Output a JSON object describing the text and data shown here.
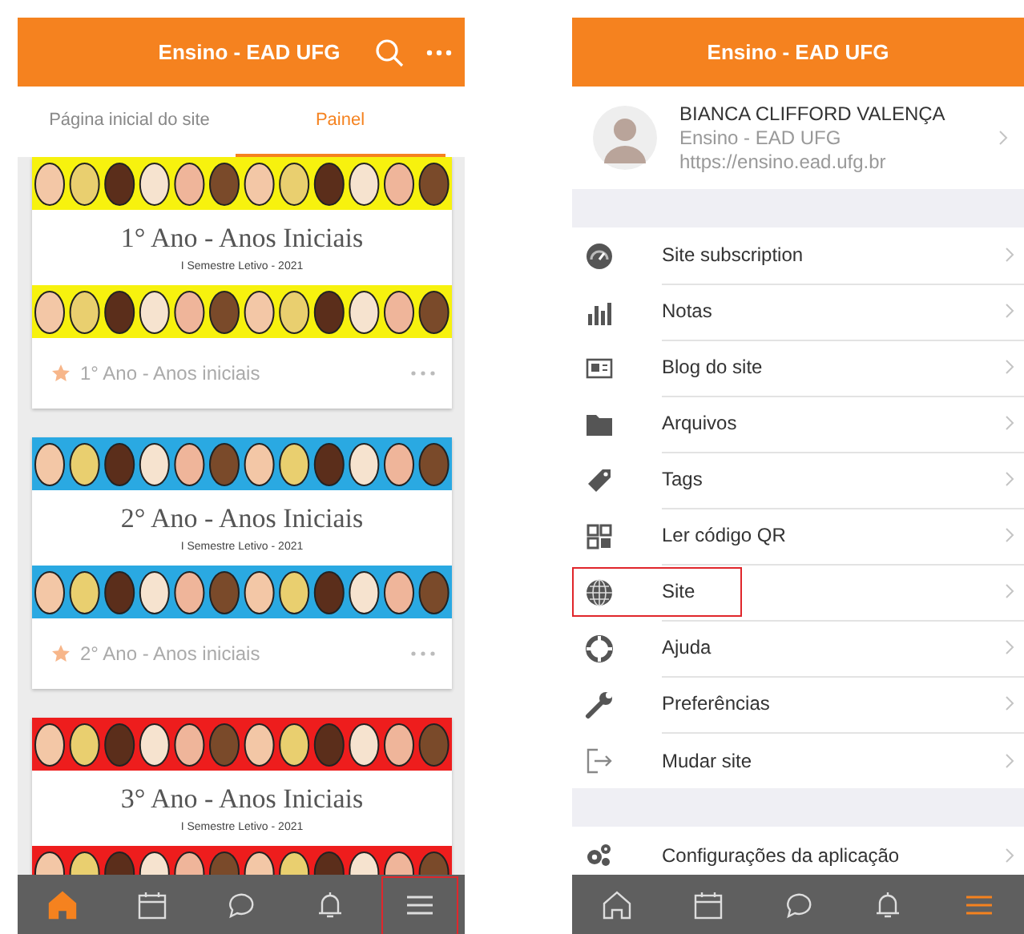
{
  "left_screen": {
    "header": {
      "title": "Ensino - EAD UFG"
    },
    "tabs": [
      {
        "label": "Página inicial do site",
        "selected": false
      },
      {
        "label": "Painel",
        "selected": true
      }
    ],
    "courses": [
      {
        "color": "#f7f20e",
        "banner_title": "1° Ano - Anos Iniciais",
        "banner_subtitle": "I Semestre Letivo - 2021",
        "name": "1° Ano - Anos iniciais",
        "starred": true
      },
      {
        "color": "#2aa9e2",
        "banner_title": "2° Ano - Anos Iniciais",
        "banner_subtitle": "I Semestre Letivo - 2021",
        "name": "2° Ano - Anos iniciais",
        "starred": true
      },
      {
        "color": "#ee1d1d",
        "banner_title": "3° Ano - Anos Iniciais",
        "banner_subtitle": "I Semestre Letivo - 2021"
      }
    ],
    "nav": [
      {
        "kind": "home",
        "selected": true,
        "highlighted": false
      },
      {
        "kind": "calendar",
        "selected": false,
        "highlighted": false
      },
      {
        "kind": "chat",
        "selected": false,
        "highlighted": false
      },
      {
        "kind": "bell",
        "selected": false,
        "highlighted": false
      },
      {
        "kind": "menu",
        "selected": false,
        "highlighted": true
      }
    ]
  },
  "right_screen": {
    "header": {
      "title": "Ensino - EAD UFG"
    },
    "profile": {
      "name": "BIANCA CLIFFORD VALENÇA",
      "site": "Ensino - EAD UFG",
      "url": "https://ensino.ead.ufg.br"
    },
    "menu_items": [
      {
        "kind": "gauge",
        "label": "Site subscription",
        "highlighted": false
      },
      {
        "kind": "chart",
        "label": "Notas",
        "highlighted": false
      },
      {
        "kind": "news",
        "label": "Blog do site",
        "highlighted": false
      },
      {
        "kind": "folder",
        "label": "Arquivos",
        "highlighted": false
      },
      {
        "kind": "tag",
        "label": "Tags",
        "highlighted": false
      },
      {
        "kind": "qr",
        "label": "Ler código QR",
        "highlighted": false
      },
      {
        "kind": "globe",
        "label": "Site",
        "highlighted": true
      },
      {
        "kind": "lifebuoy",
        "label": "Ajuda",
        "highlighted": false
      },
      {
        "kind": "wrench",
        "label": "Preferências",
        "highlighted": false
      },
      {
        "kind": "exit",
        "label": "Mudar site",
        "highlighted": false
      }
    ],
    "settings_items": [
      {
        "kind": "gears",
        "label": "Configurações da aplicação",
        "highlighted": false
      }
    ],
    "nav": [
      {
        "kind": "home",
        "selected": false,
        "highlighted": false
      },
      {
        "kind": "calendar",
        "selected": false,
        "highlighted": false
      },
      {
        "kind": "chat",
        "selected": false,
        "highlighted": false
      },
      {
        "kind": "bell",
        "selected": false,
        "highlighted": false
      },
      {
        "kind": "menu",
        "selected": true,
        "highlighted": false
      }
    ]
  }
}
